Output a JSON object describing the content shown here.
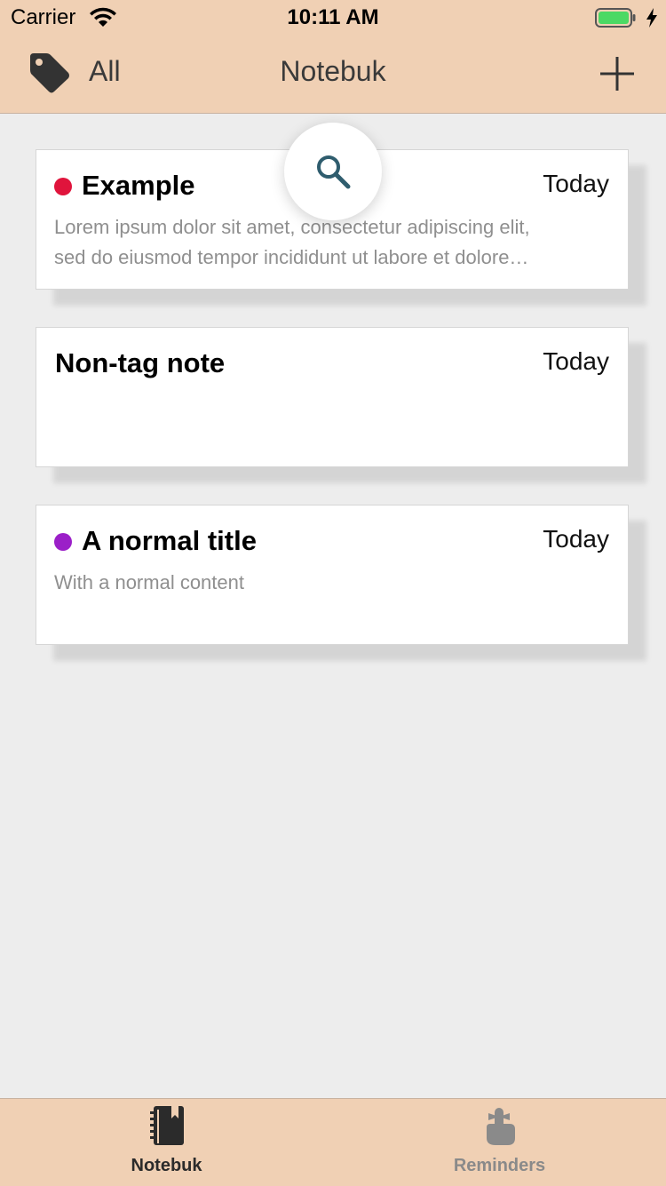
{
  "status_bar": {
    "carrier": "Carrier",
    "time": "10:11 AM"
  },
  "nav": {
    "tag_filter": "All",
    "title": "Notebuk",
    "tag_icon": "tag-icon",
    "add_icon": "plus-icon"
  },
  "search": {
    "icon": "search-icon"
  },
  "notes": [
    {
      "title": "Example",
      "date": "Today",
      "tag_color": "#e0143c",
      "body_lines": [
        "Lorem ipsum dolor sit amet, consectetur adipiscing elit,",
        "sed do eiusmod tempor incididunt ut labore et dolore…"
      ]
    },
    {
      "title": "Non-tag note",
      "date": "Today",
      "tag_color": null,
      "body_lines": []
    },
    {
      "title": "A normal title",
      "date": "Today",
      "tag_color": "#9b1fc8",
      "body_lines": [
        "With a normal content"
      ]
    }
  ],
  "tabs": [
    {
      "label": "Notebuk",
      "icon": "notebook-icon",
      "active": true
    },
    {
      "label": "Reminders",
      "icon": "finger-ribbon-icon",
      "active": false
    }
  ],
  "colors": {
    "bar_background": "#f0d0b4",
    "content_background": "#ededed",
    "search_icon": "#2f5d6e",
    "tab_active": "#2b2b2b",
    "tab_inactive": "#8a8a8a",
    "battery": "#4cd964"
  }
}
